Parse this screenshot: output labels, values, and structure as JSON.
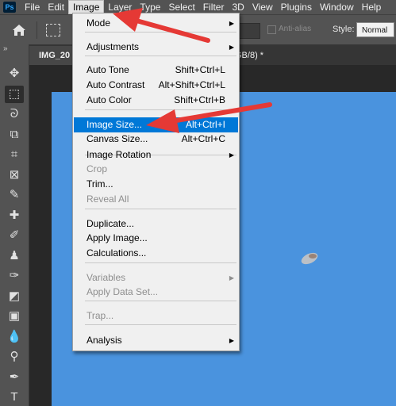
{
  "app": {
    "logo_text": "Ps"
  },
  "menubar": {
    "items": [
      {
        "label": "File"
      },
      {
        "label": "Edit"
      },
      {
        "label": "Image"
      },
      {
        "label": "Layer"
      },
      {
        "label": "Type"
      },
      {
        "label": "Select"
      },
      {
        "label": "Filter"
      },
      {
        "label": "3D"
      },
      {
        "label": "View"
      },
      {
        "label": "Plugins"
      },
      {
        "label": "Window"
      },
      {
        "label": "Help"
      }
    ],
    "active": "Image"
  },
  "options_bar": {
    "anti_alias_label": "Anti-alias",
    "style_label": "Style:",
    "style_value": "Normal"
  },
  "document_tabs": {
    "active_tab": "IMG_20",
    "second_tab_fragment": "GB/8) *",
    "close_glyph": "×"
  },
  "toolbar": {
    "collapse_glyph": "»",
    "tools": [
      {
        "icon": "move-icon",
        "glyph": "✥"
      },
      {
        "icon": "rect-marquee-icon",
        "glyph": "⬚"
      },
      {
        "icon": "lasso-icon",
        "glyph": "ᘐ"
      },
      {
        "icon": "object-select-icon",
        "glyph": "⧉"
      },
      {
        "icon": "crop-icon",
        "glyph": "⌗"
      },
      {
        "icon": "frame-icon",
        "glyph": "⊠"
      },
      {
        "icon": "eyedropper-icon",
        "glyph": "✎"
      },
      {
        "icon": "healing-brush-icon",
        "glyph": "✚"
      },
      {
        "icon": "brush-icon",
        "glyph": "✐"
      },
      {
        "icon": "clone-stamp-icon",
        "glyph": "♟"
      },
      {
        "icon": "history-brush-icon",
        "glyph": "✑"
      },
      {
        "icon": "eraser-icon",
        "glyph": "◩"
      },
      {
        "icon": "gradient-icon",
        "glyph": "▣"
      },
      {
        "icon": "blur-icon",
        "glyph": "💧"
      },
      {
        "icon": "dodge-icon",
        "glyph": "⚲"
      },
      {
        "icon": "pen-icon",
        "glyph": "✒"
      },
      {
        "icon": "type-icon",
        "glyph": "T"
      }
    ]
  },
  "image_menu": {
    "items": [
      {
        "label": "Mode",
        "submenu": true
      },
      {
        "label": "Adjustments",
        "submenu": true
      },
      {
        "label": "Auto Tone",
        "shortcut": "Shift+Ctrl+L"
      },
      {
        "label": "Auto Contrast",
        "shortcut": "Alt+Shift+Ctrl+L"
      },
      {
        "label": "Auto Color",
        "shortcut": "Shift+Ctrl+B"
      },
      {
        "label": "Image Size...",
        "shortcut": "Alt+Ctrl+I",
        "highlighted": true
      },
      {
        "label": "Canvas Size...",
        "shortcut": "Alt+Ctrl+C"
      },
      {
        "label": "Image Rotation",
        "submenu": true
      },
      {
        "label": "Crop",
        "disabled": true
      },
      {
        "label": "Trim..."
      },
      {
        "label": "Reveal All",
        "disabled": true
      },
      {
        "label": "Duplicate..."
      },
      {
        "label": "Apply Image..."
      },
      {
        "label": "Calculations..."
      },
      {
        "label": "Variables",
        "submenu": true,
        "disabled": true
      },
      {
        "label": "Apply Data Set...",
        "disabled": true
      },
      {
        "label": "Trap...",
        "disabled": true
      },
      {
        "label": "Analysis",
        "submenu": true
      }
    ],
    "submenu_glyph": "▶"
  },
  "colors": {
    "highlight": "#0078d7",
    "canvas_blue": "#4a93de",
    "annotation_red": "#e53935"
  }
}
